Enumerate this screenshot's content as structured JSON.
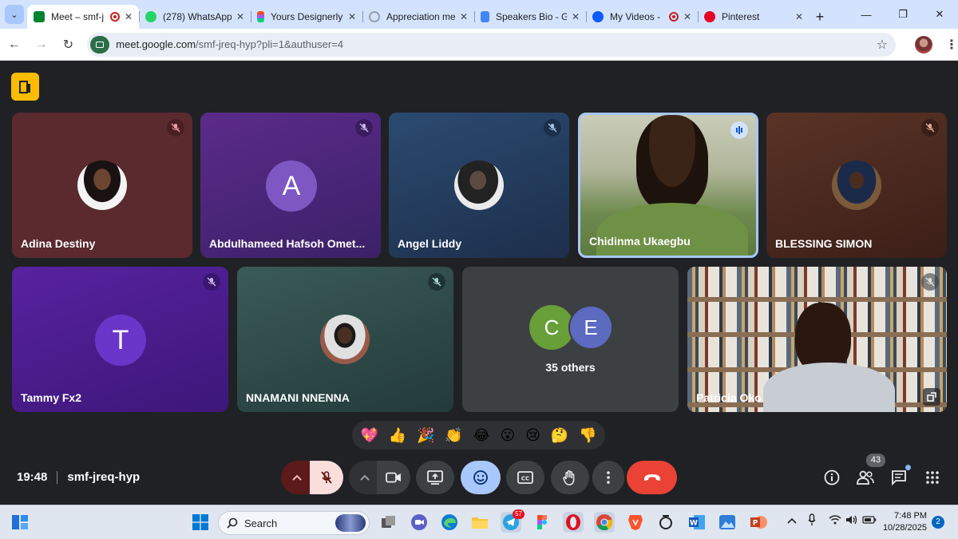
{
  "browser": {
    "tabs": [
      {
        "title": "Meet – smf-j",
        "favicon": "meet-icon",
        "recording": true,
        "active": true
      },
      {
        "title": "(278) WhatsApp",
        "favicon": "whatsapp-icon",
        "recording": false,
        "active": false
      },
      {
        "title": "Yours Designerly",
        "favicon": "figma-icon",
        "recording": false,
        "active": false
      },
      {
        "title": "Appreciation me",
        "favicon": "globe-icon",
        "recording": false,
        "active": false
      },
      {
        "title": "Speakers Bio - G",
        "favicon": "docs-icon",
        "recording": false,
        "active": false
      },
      {
        "title": "My Videos -",
        "favicon": "zoom-icon",
        "recording": true,
        "active": false
      },
      {
        "title": "Pinterest",
        "favicon": "pinterest-icon",
        "recording": false,
        "active": false
      }
    ],
    "url_host": "meet.google.com",
    "url_path": "/smf-jreq-hyp?pli=1&authuser=4"
  },
  "participants": [
    {
      "name": "Adina Destiny",
      "type": "photo",
      "muted": true,
      "bg": "#5a2a2e"
    },
    {
      "name": "Abdulhameed Hafsoh Omet...",
      "type": "letter",
      "letter": "A",
      "letter_color": "#7e57c2",
      "muted": true,
      "bg": "#4a2a78"
    },
    {
      "name": "Angel Liddy",
      "type": "photo",
      "muted": true,
      "bg": "#243a5a"
    },
    {
      "name": "Chidinma Ukaegbu",
      "type": "video",
      "muted": false,
      "speaking": true,
      "bg": "#6b7a52"
    },
    {
      "name": "BLESSING SIMON",
      "type": "photo",
      "muted": true,
      "bg": "#4a2a22"
    },
    {
      "name": "Tammy Fx2",
      "type": "letter",
      "letter": "T",
      "letter_color": "#6a35c9",
      "muted": true,
      "bg": "#4b1f86"
    },
    {
      "name": "NNAMANI NNENNA",
      "type": "photo",
      "muted": true,
      "bg": "#2e4a4a"
    },
    {
      "name": "Patricia Oko",
      "type": "video",
      "muted": true,
      "bg": "#cfc6b8"
    }
  ],
  "others": {
    "label": "35 others",
    "avatars": [
      {
        "letter": "C",
        "color": "#689f38"
      },
      {
        "letter": "E",
        "color": "#5c6bc0"
      }
    ]
  },
  "reactions": [
    "💖",
    "👍",
    "🎉",
    "👏",
    "😂",
    "😮",
    "😢",
    "🤔",
    "👎"
  ],
  "meeting": {
    "time": "19:48",
    "code": "smf-jreq-hyp",
    "participant_count": "43"
  },
  "taskbar": {
    "search_placeholder": "Search",
    "telegram_badge": "57",
    "clock_time": "7:48 PM",
    "clock_date": "10/28/2025",
    "notification_count": "2"
  },
  "colors": {
    "meet_bg": "#202124",
    "end_call": "#ea4335",
    "mic_off": "#f9dedc",
    "active_ctl": "#a8c7fa"
  }
}
